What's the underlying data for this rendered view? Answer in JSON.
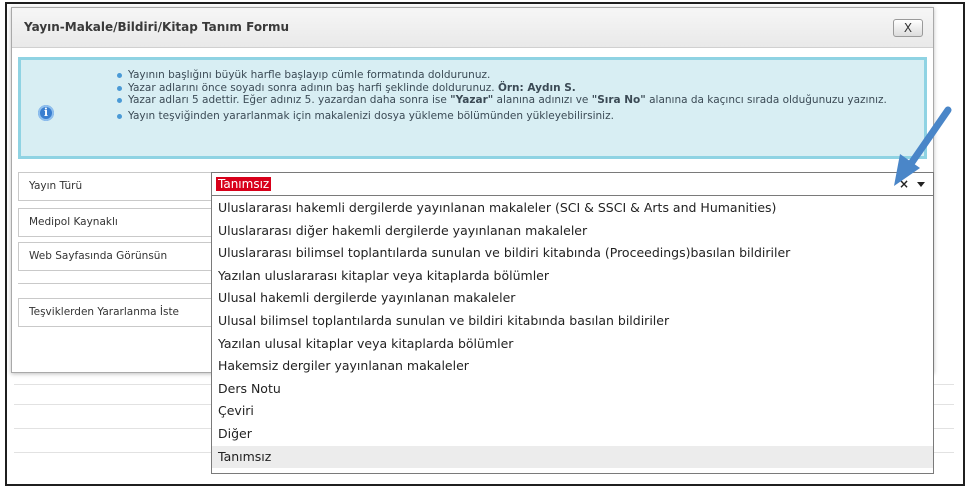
{
  "modal": {
    "title": "Yayın-Makale/Bildiri/Kitap Tanım Formu",
    "close_label": "X"
  },
  "info": {
    "icon": "info-icon",
    "items": [
      "Yayının başlığını büyük harfle başlayıp cümle formatında doldurunuz.",
      "Yazar adlarını önce soyadı sonra adının baş harfi şeklinde doldurunuz. Örn: Aydın S.",
      "Yazar adları 5 adettir. Eğer adınız 5. yazardan daha sonra ise \"Yazar\" alanına adınızı ve \"Sıra No\" alanına da kaçıncı sırada olduğunuzu yazınız.",
      "Yayın teşviğinden yararlanmak için makalenizi dosya yükleme bölümünden yükleyebilirsiniz."
    ],
    "bold_fragments": {
      "example": "Örn: Aydın S.",
      "yazar": "\"Yazar\"",
      "sira_no": "\"Sıra No\""
    }
  },
  "form": {
    "labels": {
      "yayin_turu": "Yayın Türü",
      "medipol": "Medipol Kaynaklı",
      "web": "Web Sayfasında Görünsün",
      "tesvik": "Teşviklerden Yararlanma İste"
    },
    "select": {
      "value": "Tanımsız",
      "clear_icon": "×"
    }
  },
  "dropdown": {
    "options": [
      "Uluslararası hakemli dergilerde yayınlanan makaleler (SCI & SSCI & Arts and Humanities)",
      "Uluslararası diğer hakemli dergilerde yayınlanan makaleler",
      "Uluslararası bilimsel toplantılarda sunulan ve bildiri kitabında (Proceedings)basılan bildiriler",
      "Yazılan uluslararası kitaplar veya kitaplarda bölümler",
      "Ulusal hakemli dergilerde yayınlanan makaleler",
      "Ulusal bilimsel toplantılarda sunulan ve bildiri kitabında basılan bildiriler",
      "Yazılan ulusal kitaplar veya kitaplarda bölümler",
      "Hakemsiz dergiler yayınlanan makaleler",
      "Ders Notu",
      "Çeviri",
      "Diğer",
      "Tanımsız"
    ],
    "selected_index": 11
  },
  "colors": {
    "info_bg": "#d8eef3",
    "info_border": "#8fd3e3",
    "selected_value_bg": "#d8001a",
    "annotation_arrow": "#4a86c8"
  }
}
